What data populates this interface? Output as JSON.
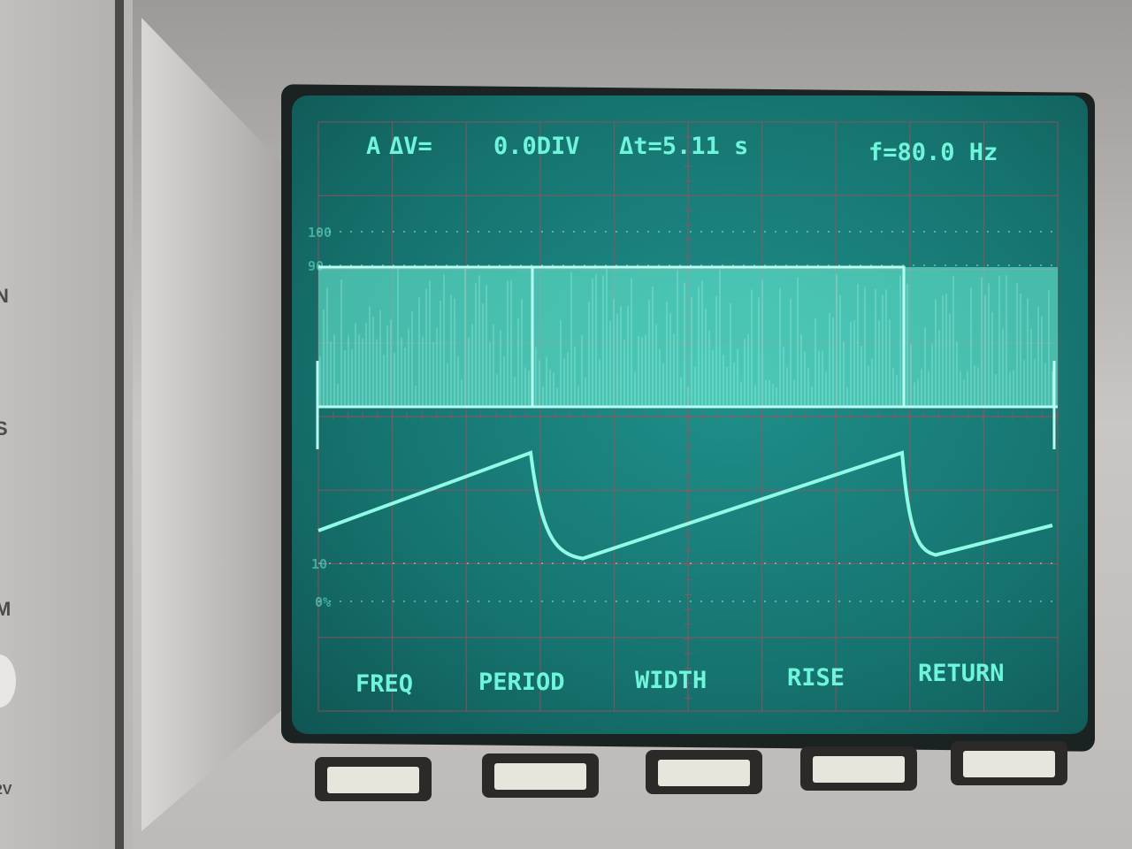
{
  "panel_labels": [
    "N",
    "S",
    "M",
    "2V"
  ],
  "readout": {
    "channel": "A",
    "delta_v": "ΔV=",
    "delta_v_value": "0.0DIV",
    "delta_t": "Δt=5.11 s",
    "frequency": "f=80.0 Hz"
  },
  "graticule_labels": {
    "top_100": "100",
    "top_90": "90",
    "bottom_10": "10",
    "bottom_0": "0%"
  },
  "softkeys": [
    "FREQ",
    "PERIOD",
    "WIDTH",
    "RISE",
    "RETURN"
  ],
  "colors": {
    "trace": "#6ff5dc",
    "screen": "#16736f",
    "grid": "#b04a5a"
  }
}
